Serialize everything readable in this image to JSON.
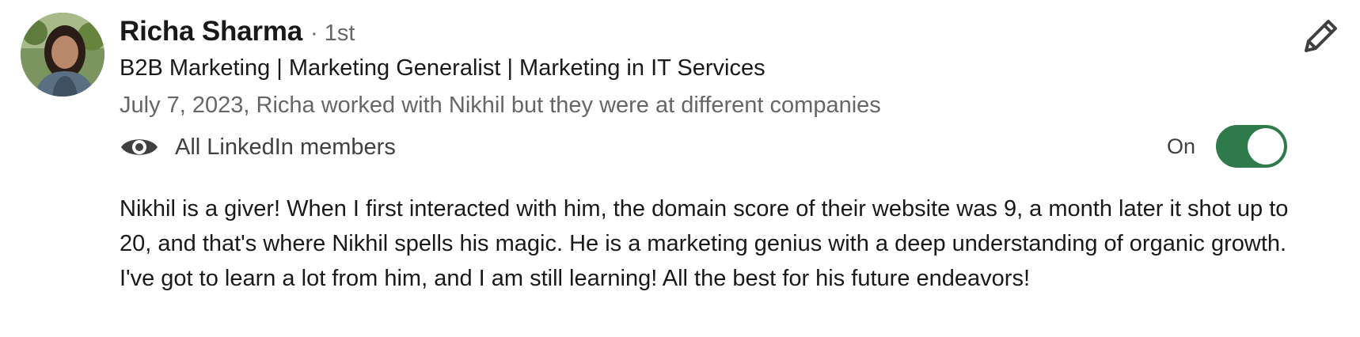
{
  "recommender": {
    "name": "Richa Sharma",
    "degree": "· 1st",
    "headline": "B2B Marketing | Marketing Generalist | Marketing in IT Services",
    "meta": "July 7, 2023, Richa worked with Nikhil but they were at different companies",
    "avatar_icon": "profile-photo"
  },
  "visibility": {
    "icon": "eye-icon",
    "label": "All LinkedIn members",
    "toggle_state_label": "On",
    "enabled": true,
    "toggle_color": "#2e7a4a"
  },
  "actions": {
    "edit_icon": "pencil-icon"
  },
  "recommendation": {
    "text": "Nikhil is a giver! When I first interacted with him, the domain score of their website was 9, a month later it shot up to 20, and that's where Nikhil spells his magic. He is a marketing genius with a deep understanding of organic growth. I've got to learn a lot from him, and I am still learning! All the best for his future endeavors!"
  }
}
